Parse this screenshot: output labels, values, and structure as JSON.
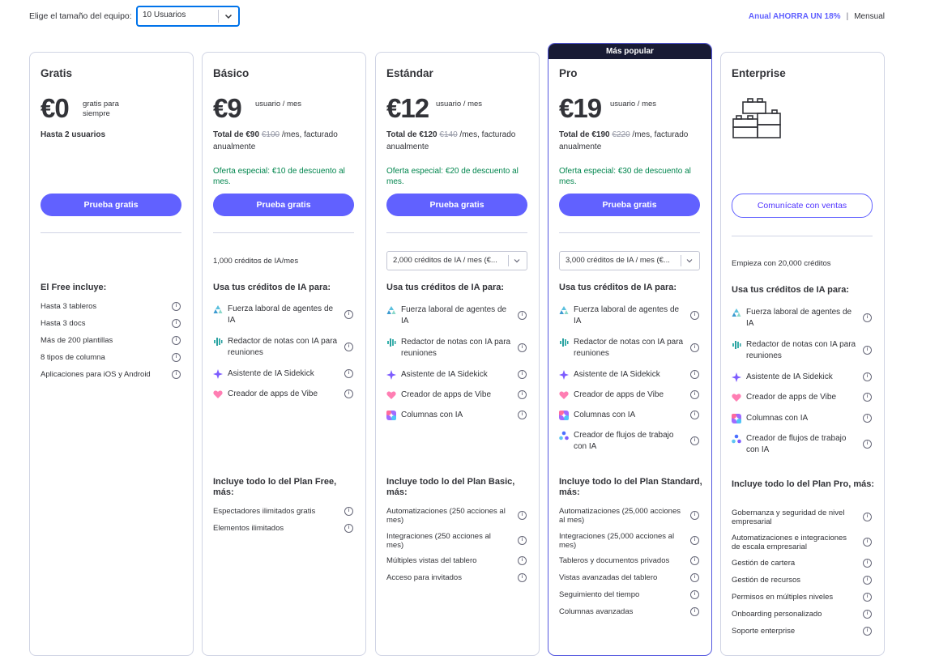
{
  "header": {
    "team_label": "Elige el tamaño del equipo:",
    "team_value": "10 Usuarios",
    "annual": "Anual AHORRA UN 18%",
    "separator": "|",
    "monthly": "Mensual"
  },
  "colors": {
    "accent": "#6161ff",
    "offer": "#00854d",
    "banner": "#181b34"
  },
  "plans": [
    {
      "name": "Gratis",
      "price": "€0",
      "unit": "gratis para siempre",
      "sub": "Hasta 2 usuarios",
      "cta": "Prueba gratis",
      "credits": "",
      "ai_title": "",
      "section_title": "El Free incluye:",
      "features": [
        "Hasta 3 tableros",
        "Hasta 3 docs",
        "Más de 200 plantillas",
        "8 tipos de columna",
        "Aplicaciones para iOS y Android"
      ]
    },
    {
      "name": "Básico",
      "price": "€9",
      "unit": "usuario / mes",
      "total_prefix": "Total de €90",
      "total_old": "€100",
      "total_suffix": " /mes, facturado anualmente",
      "offer": "Oferta especial: €10 de descuento al mes.",
      "cta": "Prueba gratis",
      "credits": "1,000 créditos de IA/mes",
      "ai_title": "Usa tus créditos de IA para:",
      "ai": [
        "Fuerza laboral de agentes de IA",
        "Redactor de notas con IA para reuniones",
        "Asistente de IA Sidekick",
        "Creador de apps de Vibe"
      ],
      "section_title": "Incluye todo lo del Plan Free, más:",
      "features": [
        "Espectadores ilimitados gratis",
        "Elementos ilimitados"
      ]
    },
    {
      "name": "Estándar",
      "price": "€12",
      "unit": "usuario / mes",
      "total_prefix": "Total de €120",
      "total_old": "€140",
      "total_suffix": " /mes, facturado anualmente",
      "offer": "Oferta especial: €20 de descuento al mes.",
      "cta": "Prueba gratis",
      "credits": "2,000 créditos de IA / mes (€...",
      "ai_title": "Usa tus créditos de IA para:",
      "ai": [
        "Fuerza laboral de agentes de IA",
        "Redactor de notas con IA para reuniones",
        "Asistente de IA Sidekick",
        "Creador de apps de Vibe",
        "Columnas con IA"
      ],
      "section_title": "Incluye todo lo del Plan Basic, más:",
      "features": [
        "Automatizaciones (250 acciones al mes)",
        "Integraciones (250 acciones al mes)",
        "Múltiples vistas del tablero",
        "Acceso para invitados"
      ]
    },
    {
      "name": "Pro",
      "badge": "Más popular",
      "price": "€19",
      "unit": "usuario / mes",
      "total_prefix": "Total de €190",
      "total_old": "€220",
      "total_suffix": " /mes, facturado anualmente",
      "offer": "Oferta especial: €30 de descuento al mes.",
      "cta": "Prueba gratis",
      "credits": "3,000 créditos de IA / mes (€...",
      "ai_title": "Usa tus créditos de IA para:",
      "ai": [
        "Fuerza laboral de agentes de IA",
        "Redactor de notas con IA para reuniones",
        "Asistente de IA Sidekick",
        "Creador de apps de Vibe",
        "Columnas con IA",
        "Creador de flujos de trabajo con IA"
      ],
      "section_title": "Incluye todo lo del Plan Standard, más:",
      "features": [
        "Automatizaciones (25,000 acciones al mes)",
        "Integraciones (25,000 acciones al mes)",
        "Tableros y documentos privados",
        "Vistas avanzadas del tablero",
        "Seguimiento del tiempo",
        "Columnas avanzadas"
      ]
    },
    {
      "name": "Enterprise",
      "cta": "Comunícate con ventas",
      "credits": "Empieza con 20,000 créditos",
      "ai_title": "Usa tus créditos de IA para:",
      "ai": [
        "Fuerza laboral de agentes de IA",
        "Redactor de notas con IA para reuniones",
        "Asistente de IA Sidekick",
        "Creador de apps de Vibe",
        "Columnas con IA",
        "Creador de flujos de trabajo con IA"
      ],
      "section_title": "Incluye todo lo del Plan Pro, más:",
      "features": [
        "Gobernanza y seguridad de nivel empresarial",
        "Automatizaciones e integraciones de escala empresarial",
        "Gestión de cartera",
        "Gestión de recursos",
        "Permisos en múltiples niveles",
        "Onboarding personalizado",
        "Soporte enterprise"
      ]
    }
  ]
}
